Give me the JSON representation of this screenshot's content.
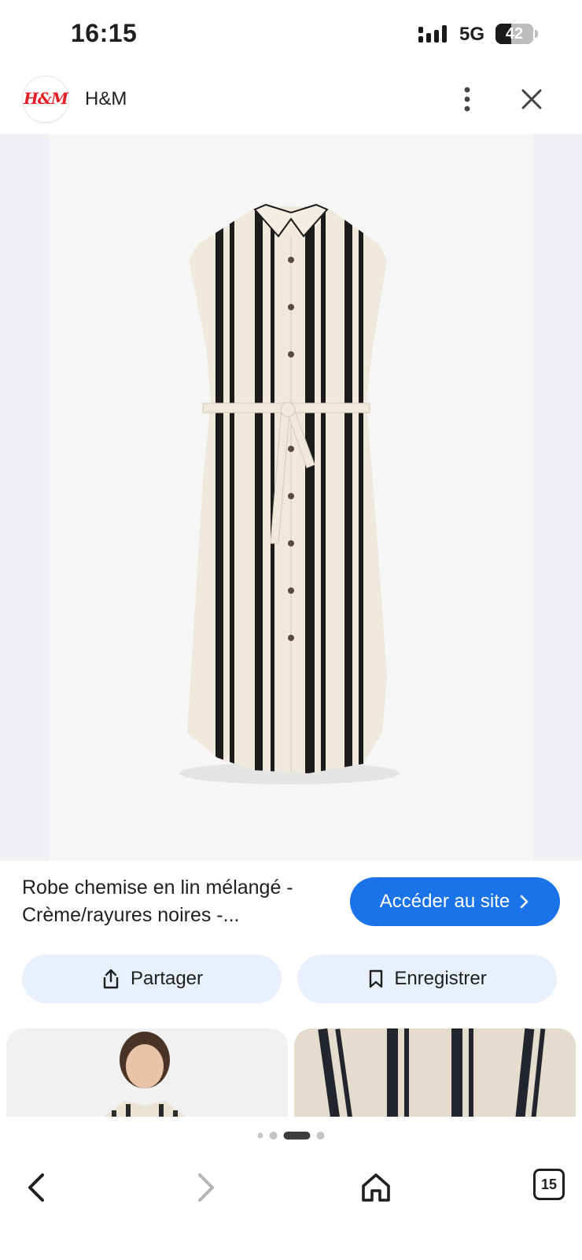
{
  "status_bar": {
    "time": "16:15",
    "network": "5G",
    "battery": "42",
    "battery_fraction": 0.42
  },
  "header": {
    "logo_text": "H&M",
    "site_name": "H&M",
    "more_icon": "vertical-dots-icon",
    "close_icon": "close-icon"
  },
  "product": {
    "title": "Robe chemise en lin mélangé - Crème/rayures noires -...",
    "visit_label": "Accéder au site",
    "share_label": "Partager",
    "save_label": "Enregistrer"
  },
  "pager": {
    "dot_count": 4,
    "active_index": 2
  },
  "bottom_nav": {
    "back_icon": "chevron-left-icon",
    "forward_icon": "chevron-right-icon",
    "home_icon": "home-icon",
    "tab_count": "15"
  },
  "colors": {
    "accent": "#1a73e8",
    "chip": "#e8f0fe",
    "brand_red": "#e41e26",
    "dress_cream": "#efe9dc",
    "dress_stripe": "#1c1c1c"
  }
}
